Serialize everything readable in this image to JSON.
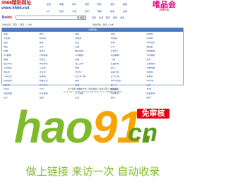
{
  "header": {
    "logo_main": "5566精彩网址",
    "logo_url": "www.5566.net",
    "nav": [
      "新闻",
      "军事",
      "体育",
      "财经",
      "娱乐",
      "游戏",
      "邮箱",
      "QQ",
      "影视",
      "小说",
      "音乐",
      "购物",
      "旅游",
      "彩票"
    ],
    "brand_main": "唯品会",
    "brand_sub": "品牌特卖"
  },
  "search": {
    "engine": "Bai du",
    "input_value": "",
    "button_label": "搜索",
    "quicklinks": [
      "百度",
      "新浪",
      "腾讯",
      "网易",
      "淘宝"
    ]
  },
  "breadcrumb": {
    "left": "当前位置：首页 > 频道 > 分类",
    "right": "网站导航 | 更多 | 分类"
  },
  "panel": {
    "title": "分类导航",
    "links": [
      "新浪",
      "腾讯",
      "网易",
      "搜狐",
      "凤凰网",
      "人民网",
      "新华网",
      "央视网",
      "中新网",
      "环球网",
      "百度",
      "谷歌",
      "必应",
      "搜狗",
      "360搜索",
      "淘宝",
      "京东",
      "天猫",
      "苏宁",
      "唯品会",
      "优酷",
      "爱奇艺",
      "腾讯视频",
      "芒果TV",
      "哔哩哔哩",
      "QQ邮箱",
      "163邮箱",
      "126邮箱",
      "新浪邮箱",
      "139邮箱",
      "携程",
      "去哪儿",
      "同程",
      "飞猪",
      "途牛",
      "起点中文",
      "纵横中文",
      "晋江文学",
      "红袖添香",
      "潇湘书院",
      "东方财富",
      "同花顺",
      "雪球",
      "和讯",
      "证券时报",
      "中关村",
      "太平洋",
      "IT之家",
      "驱动之家",
      "泡泡网",
      "汽车之家",
      "易车网",
      "太平洋汽车",
      "爱卡汽车",
      "懂车帝",
      "智联招聘",
      "前程无忧",
      "猎聘",
      "BOSS直聘",
      "58同城",
      "赶集网",
      "大众点评",
      "美团",
      "饿了么",
      "口碑",
      "4399",
      "7k7k",
      "17173",
      "游民星空",
      "3DM",
      "百度地图",
      "高德地图",
      "天气预报",
      "列车时刻",
      "快递查询",
      "知乎",
      "豆瓣",
      "天涯",
      "贴吧",
      "微博"
    ]
  },
  "footer": {
    "links": "关于我们 | 联系方式 | 网站地图 | 免责声明 | 友情链接",
    "copyright": "Copyright © 2006-2025 All Rights Reserved. 京ICP备00000000号"
  },
  "banner": {
    "logo_hao": "hao",
    "logo_num": "91",
    "logo_dot": ".",
    "logo_cn": "cn",
    "badge": "免审核",
    "slogan": "做上链接  来访一次  自动收录"
  }
}
